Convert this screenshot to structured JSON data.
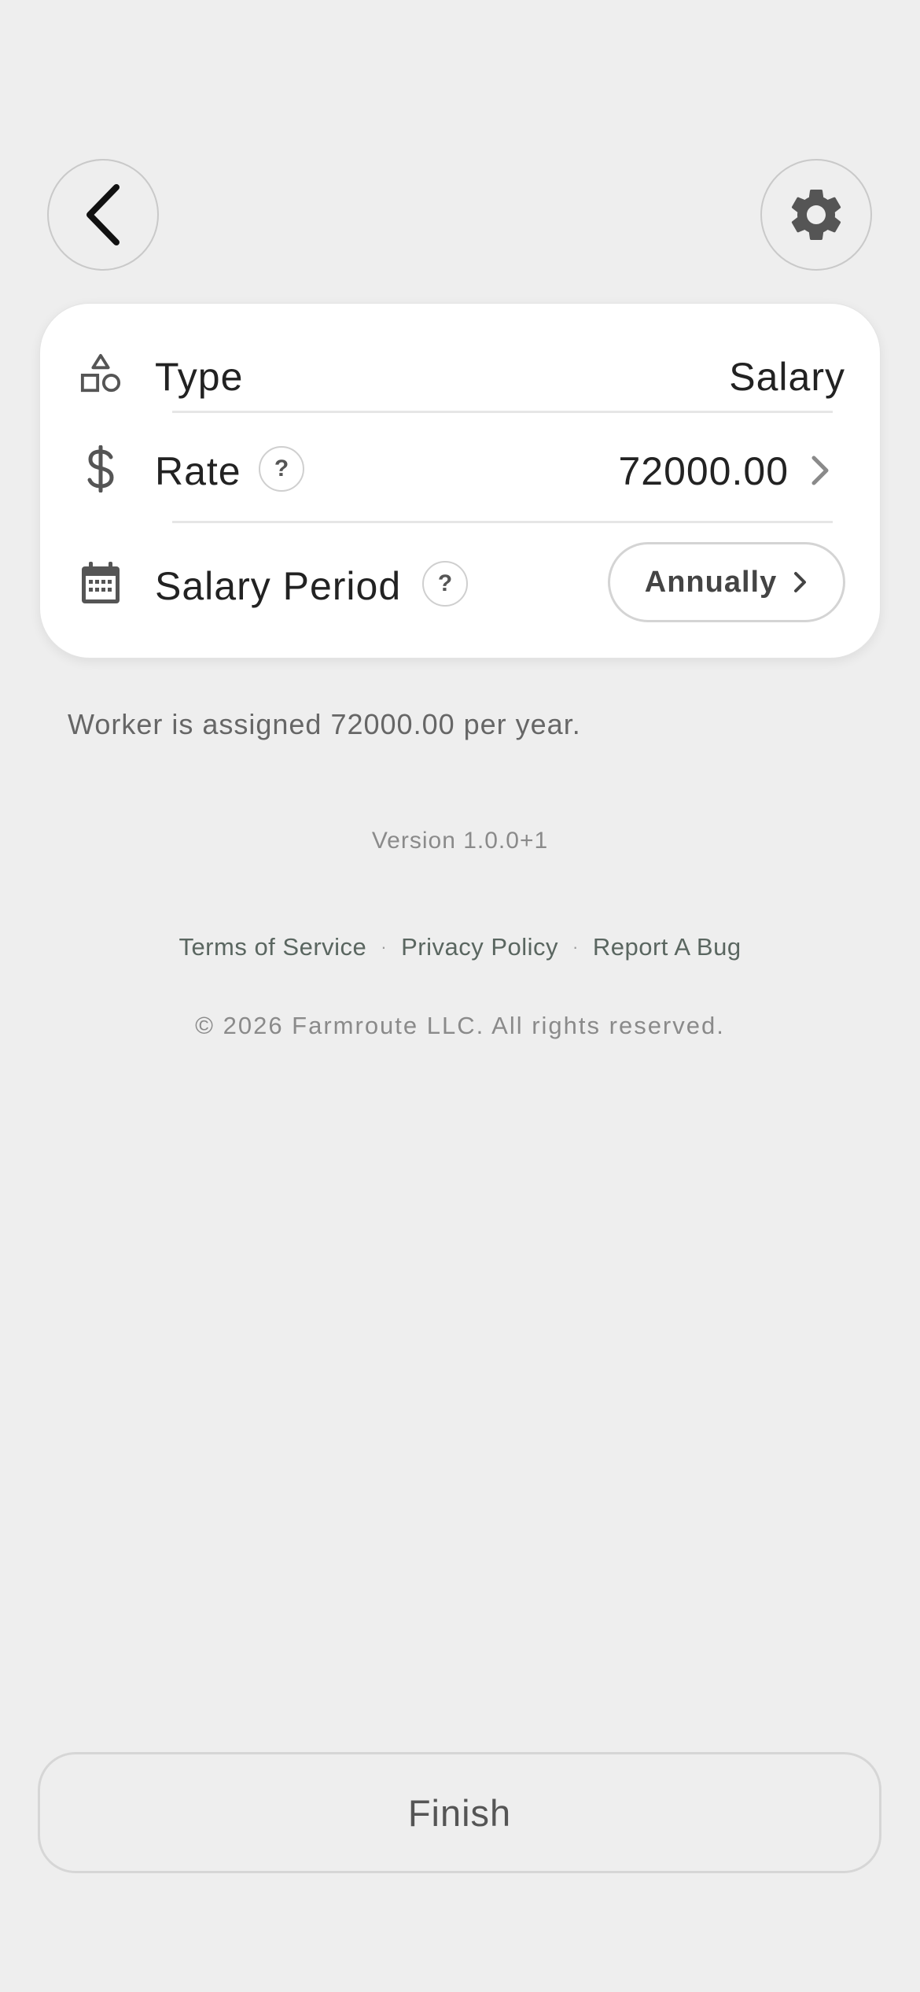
{
  "header": {
    "back_icon": "chevron-left-icon",
    "settings_icon": "gear-icon"
  },
  "card": {
    "type_row": {
      "icon": "shapes-icon",
      "label": "Type",
      "value": "Salary"
    },
    "rate_row": {
      "icon": "dollar-icon",
      "label": "Rate",
      "help": "?",
      "value": "72000.00",
      "chevron": "chevron-right-icon"
    },
    "period_row": {
      "icon": "calendar-icon",
      "label": "Salary Period",
      "help": "?",
      "value": "Annually",
      "chevron": "chevron-right-icon"
    }
  },
  "summary": "Worker is assigned 72000.00 per year.",
  "footer": {
    "version": "Version 1.0.0+1",
    "links": [
      "Terms of Service",
      "Privacy Policy",
      "Report A Bug"
    ],
    "separator": "·",
    "copyright": "© 2026 Farmroute LLC. All rights reserved."
  },
  "finish_label": "Finish"
}
